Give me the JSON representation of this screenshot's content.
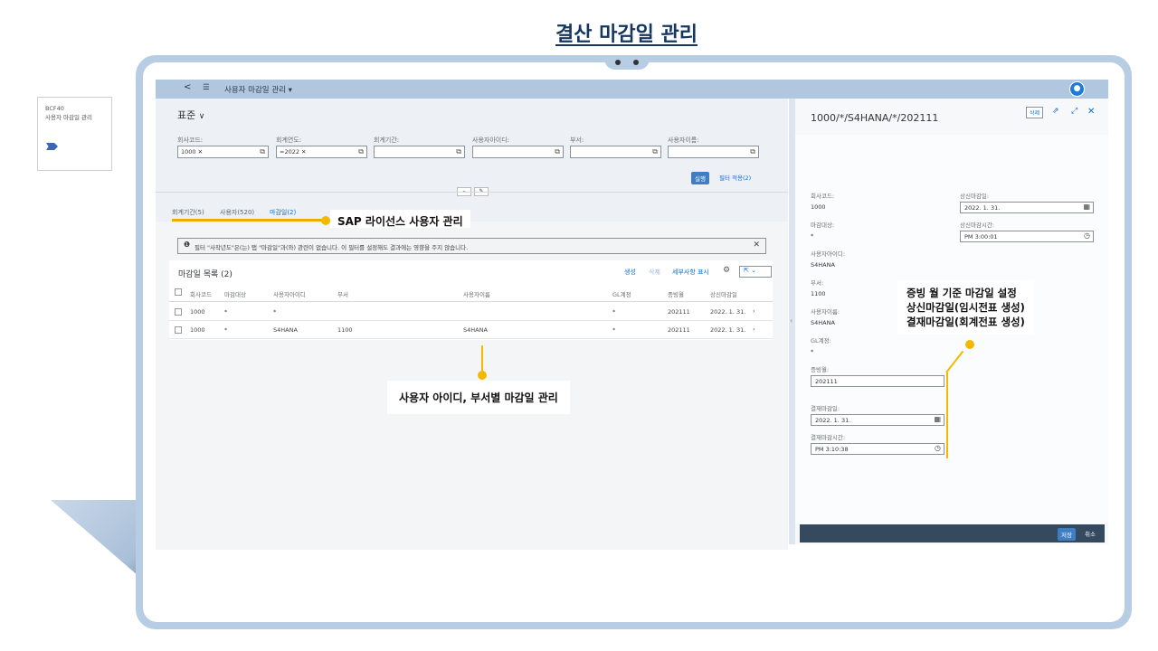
{
  "slide_title": "결산 마감일 관리",
  "side_card": {
    "code": "BCF40",
    "name": "사용자 마감일 관리"
  },
  "shellbar": {
    "back": "<",
    "menu": "☰",
    "title": "사용자 마감일 관리 ▾",
    "avatar_icon": "user-icon"
  },
  "variant": {
    "label": "표준",
    "caret": "∨"
  },
  "filters": [
    {
      "label": "회사코드:",
      "value": "1000 ✕"
    },
    {
      "label": "회계연도:",
      "value": "=2022 ✕"
    },
    {
      "label": "회계기간:",
      "value": ""
    },
    {
      "label": "사용자아이디:",
      "value": ""
    },
    {
      "label": "부서:",
      "value": ""
    },
    {
      "label": "사용자이름:",
      "value": ""
    }
  ],
  "filter_buttons": {
    "go": "실행",
    "adapt": "필터 적용(2)"
  },
  "tabs": [
    {
      "label": "회계기간(5)"
    },
    {
      "label": "사용자(520)"
    },
    {
      "label": "마감일(2)",
      "active": true
    }
  ],
  "callout_license": "SAP 라이선스 사용자 관리",
  "message_strip": {
    "text": "필터 \"사작년도\"은(는) 탭 \"마감일\"과(와) 관련이 없습니다. 이 필터를 설정해도 결과에는 영향을 주지 않습니다.",
    "close": "✕"
  },
  "table": {
    "title": "마감일 목록 (2)",
    "actions": {
      "create": "생성",
      "delete": "삭제",
      "details": "세부사항 표시"
    },
    "columns": [
      "회사코드",
      "마감대상",
      "사용자아이디",
      "부서",
      "사용자이름",
      "GL계정",
      "증빙월",
      "상신마감일"
    ],
    "rows": [
      [
        "1000",
        "*",
        "*",
        "",
        "",
        "*",
        "202111",
        "2022. 1. 31."
      ],
      [
        "1000",
        "*",
        "S4HANA",
        "1100",
        "S4HANA",
        "*",
        "202111",
        "2022. 1. 31."
      ]
    ]
  },
  "callout_user": "사용자 아이디, 부서별 마감일 관리",
  "detail": {
    "title": "1000/*/S4HANA/*/202111",
    "delete": "삭제",
    "fields_left": [
      {
        "label": "회사코드:",
        "value": "1000"
      },
      {
        "label": "마감대상:",
        "value": "*"
      },
      {
        "label": "사용자아이디:",
        "value": "S4HANA"
      },
      {
        "label": "부서:",
        "value": "1100"
      },
      {
        "label": "사용자이름:",
        "value": "S4HANA"
      },
      {
        "label": "GL계정:",
        "value": "*"
      }
    ],
    "submit_date_label": "상신마감일:",
    "submit_date": "2022. 1. 31.",
    "submit_time_label": "상신마감시간:",
    "submit_time": "PM  3:00:01",
    "period_label": "증빙월:",
    "period": "202111",
    "close_date_label": "결재마감일:",
    "close_date": "2022. 1. 31.",
    "close_time_label": "결재마감시간:",
    "close_time": "PM  3:10:38",
    "save": "저장",
    "cancel": "취소"
  },
  "callout_right": [
    "증빙 월 기준 마감일 설정",
    "상신마감일(임시전표  생성)",
    "결재마감일(회계전표  생성)"
  ],
  "colors": {
    "accent": "#f5b800",
    "brand": "#14365f",
    "frame": "#b7cde4",
    "button": "#3f7ec2"
  }
}
